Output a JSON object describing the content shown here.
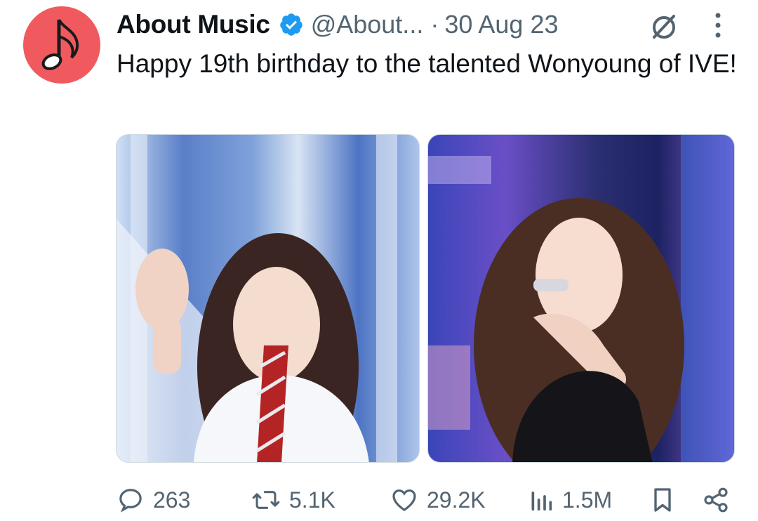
{
  "author": {
    "display_name": "About Music",
    "handle": "@About...",
    "separator": "·",
    "date": "30 Aug 23",
    "verified": true,
    "avatar_color": "#f05a5f"
  },
  "tweet": {
    "text": "Happy 19th birthday to the talented Wonyoung of IVE!"
  },
  "media": [
    {
      "icon": "photo"
    },
    {
      "icon": "photo"
    }
  ],
  "actions": {
    "replies": "263",
    "reposts": "5.1K",
    "likes": "29.2K",
    "views": "1.5M"
  },
  "colors": {
    "text": "#0f1419",
    "secondary": "#536471",
    "verified": "#1d9bf0"
  }
}
